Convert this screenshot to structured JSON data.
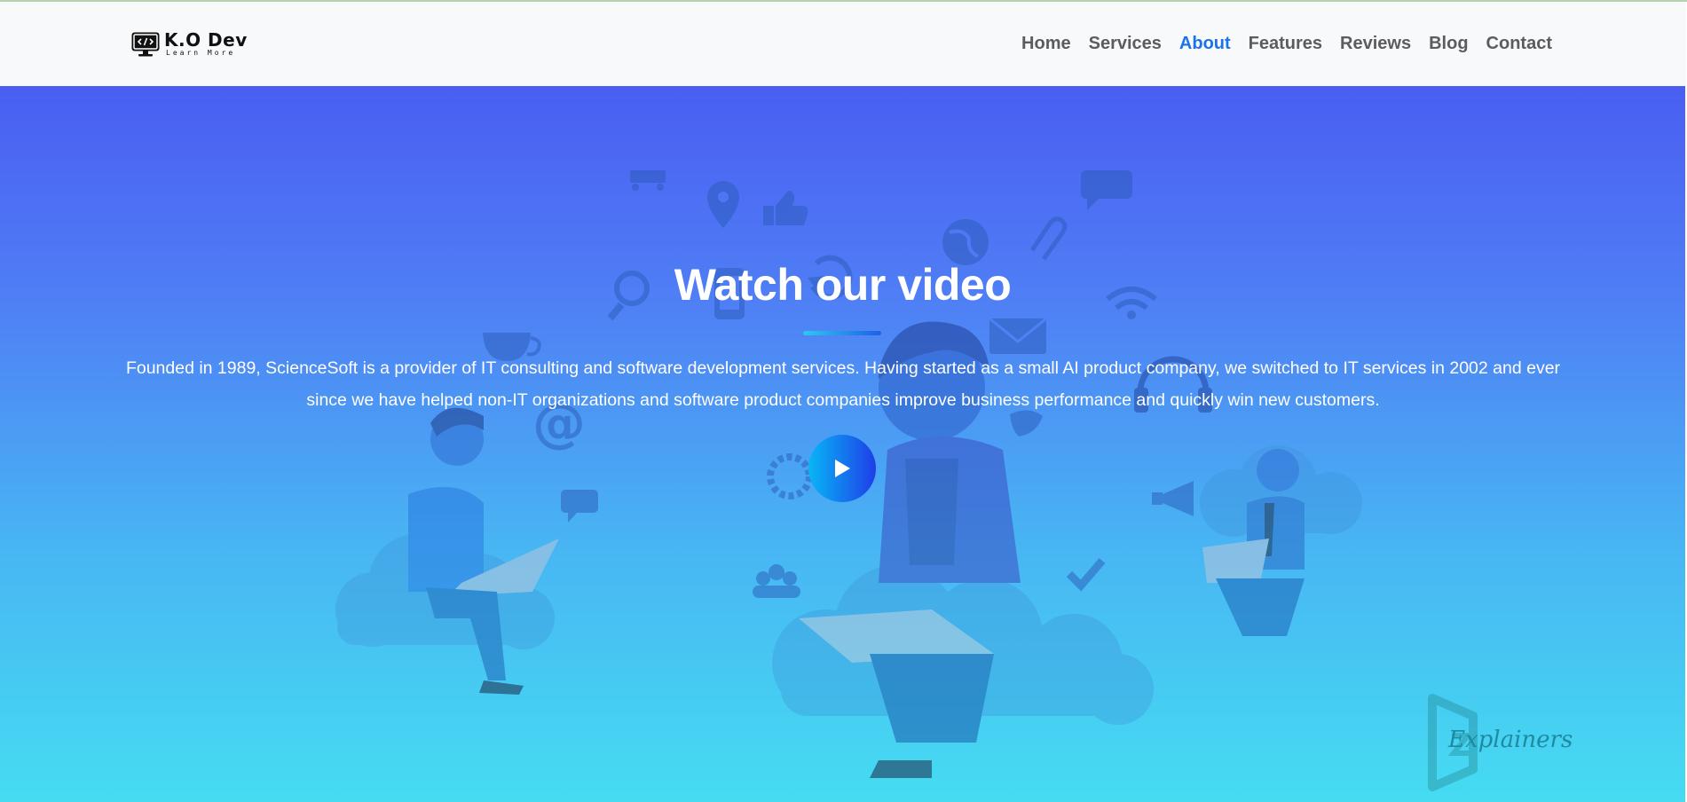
{
  "brand": {
    "name": "K.O Dev",
    "tagline": "Learn More",
    "logo_icon": "code-monitor-icon"
  },
  "nav": {
    "items": [
      {
        "label": "Home",
        "active": false
      },
      {
        "label": "Services",
        "active": false
      },
      {
        "label": "About",
        "active": true
      },
      {
        "label": "Features",
        "active": false
      },
      {
        "label": "Reviews",
        "active": false
      },
      {
        "label": "Blog",
        "active": false
      },
      {
        "label": "Contact",
        "active": false
      }
    ]
  },
  "hero": {
    "title": "Watch our video",
    "description": "Founded in 1989, ScienceSoft is a provider of IT consulting and software development services. Having started as a small AI product company, we switched to IT services in 2002 and ever since we have helped non-IT organizations and software product companies improve business performance and quickly win new customers.",
    "play_icon": "play-icon",
    "watermark": "Explainers"
  },
  "colors": {
    "accent": "#1a73e8",
    "nav_text": "#5c5c5c",
    "hero_top": "#4a5ef2",
    "hero_bottom": "#45dcf2",
    "play_start": "#08b6f6",
    "play_end": "#1f3ee8"
  }
}
